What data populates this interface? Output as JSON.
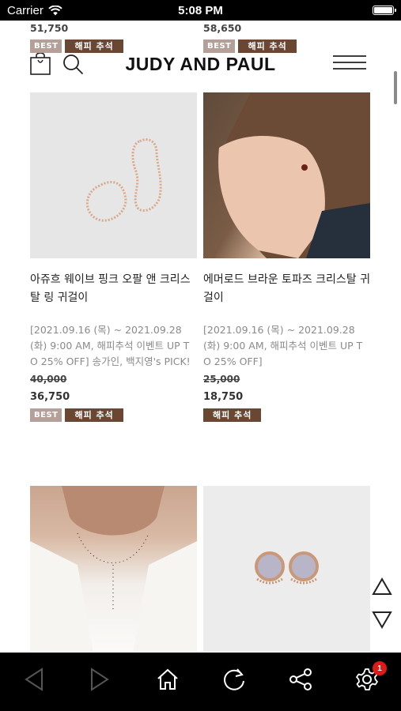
{
  "status_bar": {
    "carrier": "Carrier",
    "time": "5:08 PM"
  },
  "top_row": {
    "left_price": "51,750",
    "right_price": "58,650",
    "tag_best": "BEST",
    "tag_happy": "해피 추석"
  },
  "header": {
    "logo": "JUDY AND PAUL"
  },
  "products": [
    {
      "name": "아쥬흐 웨이브 핑크 오팔 앤 크리스탈 링 귀걸이",
      "desc": "[2021.09.16 (목) ~ 2021.09.28 (화) 9:00 AM, 해피추석 이벤트 UP TO 25% OFF] 송가인, 백지영's PICK!",
      "old_price": "40,000",
      "price": "36,750",
      "tags": [
        "BEST",
        "해피 추석"
      ]
    },
    {
      "name": "에머로드 브라운 토파즈 크리스탈 귀걸이",
      "desc": "[2021.09.16 (목) ~ 2021.09.28 (화) 9:00 AM, 해피추석 이벤트 UP TO 25% OFF]",
      "old_price": "25,000",
      "price": "18,750",
      "tags": [
        "해피 추석"
      ]
    }
  ],
  "bottom_bar": {
    "settings_badge": "1"
  }
}
